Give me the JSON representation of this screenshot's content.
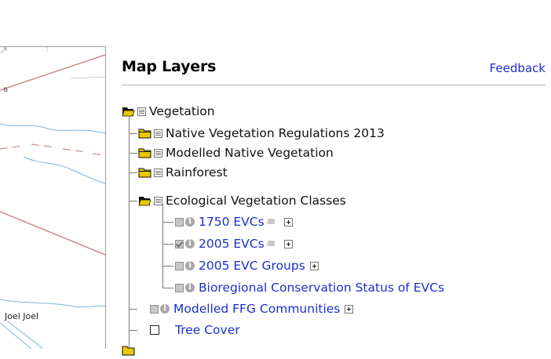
{
  "map": {
    "label": "Joel Joel"
  },
  "panel": {
    "title": "Map Layers",
    "feedback_label": "Feedback"
  },
  "layers": {
    "vegetation": "Vegetation",
    "native_veg_regs": "Native Vegetation Regulations 2013",
    "modelled_native": "Modelled Native Vegetation",
    "rainforest": "Rainforest",
    "evc_group": "Ecological Vegetation Classes",
    "evc_1750": "1750 EVCs",
    "evc_2005": "2005 EVCs",
    "evc_groups_2005": "2005 EVC Groups",
    "bioregional": "Bioregional Conservation Status of EVCs",
    "ffg": "Modelled FFG Communities",
    "tree_cover": "Tree Cover"
  },
  "colors": {
    "link": "#1b2fc9",
    "folder": "#e8c800"
  }
}
